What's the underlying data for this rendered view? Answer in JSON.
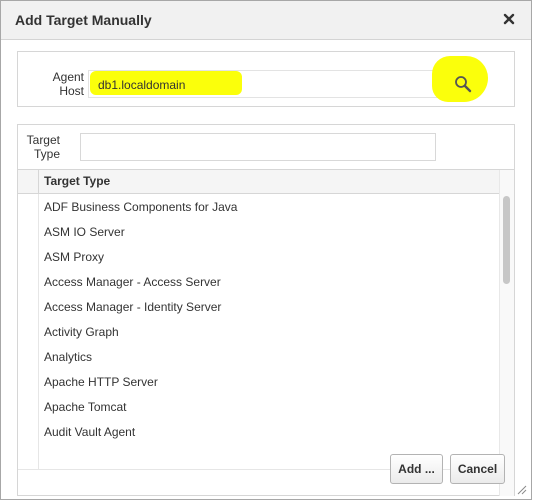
{
  "dialog": {
    "title": "Add Target Manually"
  },
  "agent_host": {
    "label": "Agent Host",
    "value": "db1.localdomain"
  },
  "target_type": {
    "label": "Target Type",
    "value": ""
  },
  "table": {
    "header": "Target Type",
    "rows": [
      "ADF Business Components for Java",
      "ASM IO Server",
      "ASM Proxy",
      "Access Manager - Access Server",
      "Access Manager - Identity Server",
      "Activity Graph",
      "Analytics",
      "Apache HTTP Server",
      "Apache Tomcat",
      "Audit Vault Agent",
      ""
    ]
  },
  "buttons": {
    "add": "Add ...",
    "cancel": "Cancel"
  },
  "colors": {
    "highlight": "#fbff0b"
  },
  "icons": [
    "close-icon",
    "search-icon",
    "resize-grip-icon"
  ]
}
